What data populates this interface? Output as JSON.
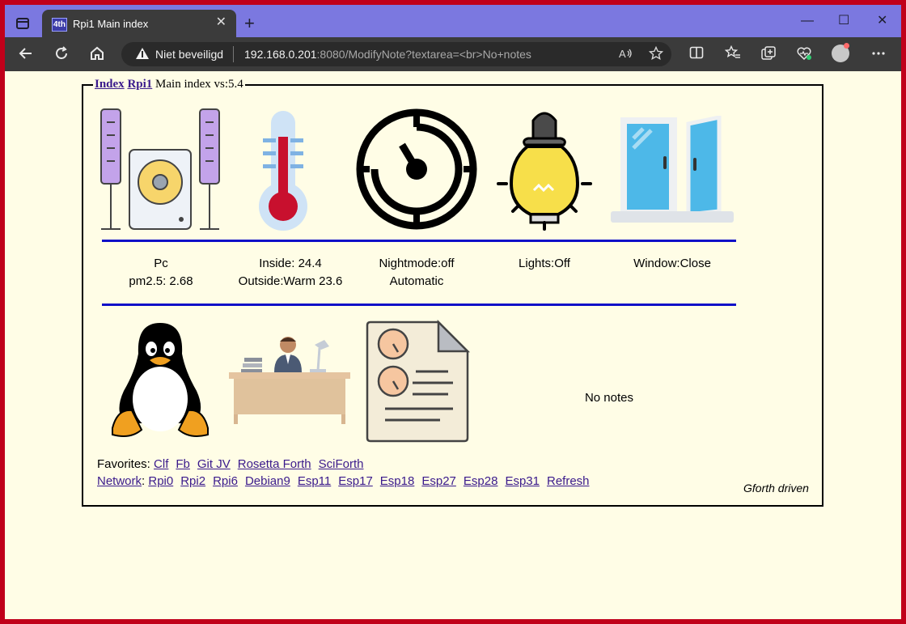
{
  "browser": {
    "tab_title": "Rpi1 Main index",
    "favicon_text": "4th",
    "new_tab": "+",
    "close": "✕",
    "minimize": "—",
    "maximize": "☐",
    "window_close": "✕",
    "security_status": "Niet beveiligd",
    "url_host": "192.168.0.201",
    "url_rest": ":8080/ModifyNote?textarea=<br>No+notes"
  },
  "page": {
    "legend": {
      "index_link": "Index",
      "rpi_link": "Rpi1",
      "title_text": " Main index vs:5.4"
    },
    "status": [
      {
        "line1": "Pc",
        "line2": "pm2.5: 2.68"
      },
      {
        "line1": "Inside: 24.4",
        "line2": "Outside:Warm 23.6"
      },
      {
        "line1": "Nightmode:off",
        "line2": "Automatic"
      },
      {
        "line1": "Lights:Off",
        "line2": ""
      },
      {
        "line1": "Window:Close",
        "line2": ""
      }
    ],
    "notes": "No notes",
    "favorites_label": "Favorites: ",
    "favorites": [
      "Clf",
      "Fb",
      "Git JV",
      "Rosetta Forth",
      "SciForth"
    ],
    "network_label": "Network",
    "network_sep": ": ",
    "network": [
      "Rpi0",
      "Rpi2",
      "Rpi6",
      "Debian9",
      "Esp11",
      "Esp17",
      "Esp18",
      "Esp27",
      "Esp28",
      "Esp31",
      "Refresh"
    ],
    "footer": "Gforth driven"
  },
  "colors": {
    "accent_line": "#1010c8",
    "link": "#3a1a8c",
    "page_bg": "#fffde6",
    "frame": "#c0001a",
    "tabbar": "#7b78e0"
  }
}
